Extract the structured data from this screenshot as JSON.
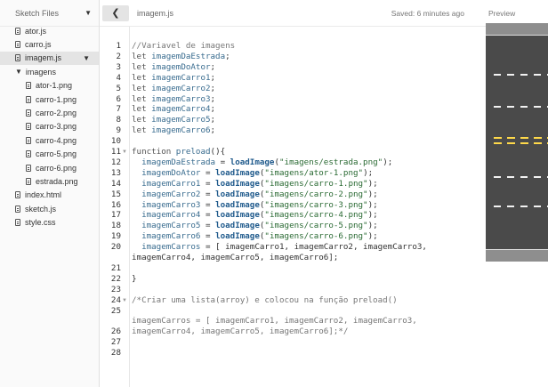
{
  "sidebar": {
    "header": "Sketch Files",
    "files": [
      {
        "label": "ator.js",
        "level": 0,
        "type": "file"
      },
      {
        "label": "carro.js",
        "level": 0,
        "type": "file"
      },
      {
        "label": "imagem.js",
        "level": 0,
        "type": "file",
        "selected": true
      },
      {
        "label": "imagens",
        "level": 0,
        "type": "folder"
      },
      {
        "label": "ator-1.png",
        "level": 1,
        "type": "file"
      },
      {
        "label": "carro-1.png",
        "level": 1,
        "type": "file"
      },
      {
        "label": "carro-2.png",
        "level": 1,
        "type": "file"
      },
      {
        "label": "carro-3.png",
        "level": 1,
        "type": "file"
      },
      {
        "label": "carro-4.png",
        "level": 1,
        "type": "file"
      },
      {
        "label": "carro-5.png",
        "level": 1,
        "type": "file"
      },
      {
        "label": "carro-6.png",
        "level": 1,
        "type": "file"
      },
      {
        "label": "estrada.png",
        "level": 1,
        "type": "file"
      },
      {
        "label": "index.html",
        "level": 0,
        "type": "file"
      },
      {
        "label": "sketch.js",
        "level": 0,
        "type": "file"
      },
      {
        "label": "style.css",
        "level": 0,
        "type": "file"
      }
    ]
  },
  "editor": {
    "collapse_icon": "chevron-left-icon",
    "file_name": "imagem.js",
    "saved_status": "Saved: 6 minutes ago",
    "line_numbers": [
      "1",
      "2",
      "3",
      "4",
      "5",
      "6",
      "7",
      "8",
      "9",
      "10",
      "11",
      "12",
      "13",
      "14",
      "15",
      "16",
      "17",
      "18",
      "19",
      "20",
      "21",
      "22",
      "23",
      "24",
      "25",
      "26",
      "27",
      "28"
    ],
    "code_lines": [
      "//Variavel de imagens",
      "let imagemDaEstrada;",
      "let imagemDoAtor;",
      "let imagemCarro1;",
      "let imagemCarro2;",
      "let imagemCarro3;",
      "let imagemCarro4;",
      "let imagemCarro5;",
      "let imagemCarro6;",
      "",
      "function preload(){",
      "  imagemDaEstrada = loadImage(\"imagens/estrada.png\");",
      "  imagemDoAtor = loadImage(\"imagens/ator-1.png\");",
      "  imagemCarro1 = loadImage(\"imagens/carro-1.png\");",
      "  imagemCarro2 = loadImage(\"imagens/carro-2.png\");",
      "  imagemCarro3 = loadImage(\"imagens/carro-3.png\");",
      "  imagemCarro4 = loadImage(\"imagens/carro-4.png\");",
      "  imagemCarro5 = loadImage(\"imagens/carro-5.png\");",
      "  imagemCarro6 = loadImage(\"imagens/carro-6.png\");",
      "  imagemCarros = [ imagemCarro1, imagemCarro2, imagemCarro3,",
      "imagemCarro4, imagemCarro5, imagemCarro6];",
      "",
      "}",
      "",
      "/*Criar uma lista(arroy) e colocou na função preload()",
      "",
      "imagemCarros = [ imagemCarro1, imagemCarro2, imagemCarro3,",
      "imagemCarro4, imagemCarro5, imagemCarro6];*/",
      "",
      ""
    ]
  },
  "preview": {
    "label": "Preview"
  },
  "colors": {
    "road": "#4a4a4a",
    "curb": "#8e8e8e",
    "lane_white": "#f2f2f2",
    "lane_yellow": "#ffd94a",
    "selected_row": "#e4e4e4"
  }
}
